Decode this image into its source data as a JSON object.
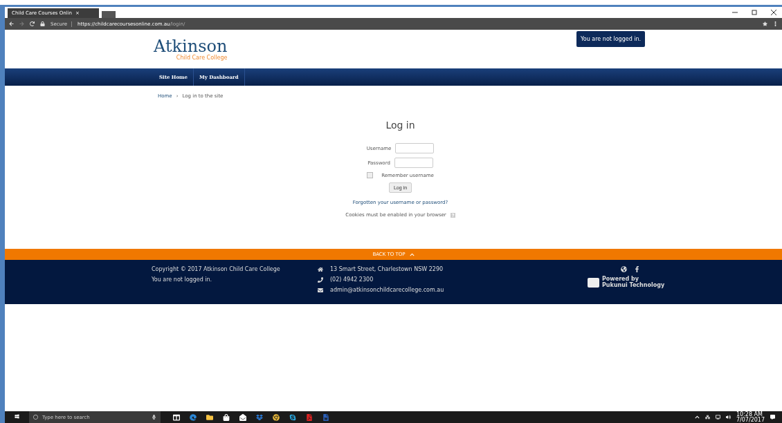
{
  "browser": {
    "tab_title": "Child Care Courses Onlin",
    "tab_close": "×",
    "secure_label": "Secure",
    "url_host": "https://childcarecoursesonline.com.au",
    "url_path": "/login/"
  },
  "header": {
    "logo_name": "Atkinson",
    "logo_tagline": "Child Care College",
    "notice": "You are not logged in."
  },
  "nav": [
    {
      "label": "Site Home",
      "selected": false
    },
    {
      "label": "My Dashboard",
      "selected": false
    }
  ],
  "breadcrumb": {
    "home": "Home",
    "separator": "›",
    "current": "Log in to the site"
  },
  "login": {
    "title": "Log in",
    "username_label": "Username",
    "password_label": "Password",
    "remember_label": "Remember username",
    "remember_checked": false,
    "button": "Log in",
    "forgot_link": "Forgotten your username or password?",
    "cookies_note": "Cookies must be enabled in your browser"
  },
  "back_to_top": "BACK TO TOP",
  "footer": {
    "copyright": "Copyright © 2017 Atkinson Child Care College",
    "login_status": "You are not logged in.",
    "address": "13 Smart Street, Charlestown NSW 2290",
    "phone": "(02) 4942 2300",
    "email": "admin@atkinsonchildcarecollege.com.au",
    "powered_line1": "Powered by",
    "powered_line2": "Pukunui Technology"
  },
  "taskbar": {
    "search_placeholder": "Type here to search",
    "time": "10:28 AM",
    "date": "7/07/2017"
  }
}
